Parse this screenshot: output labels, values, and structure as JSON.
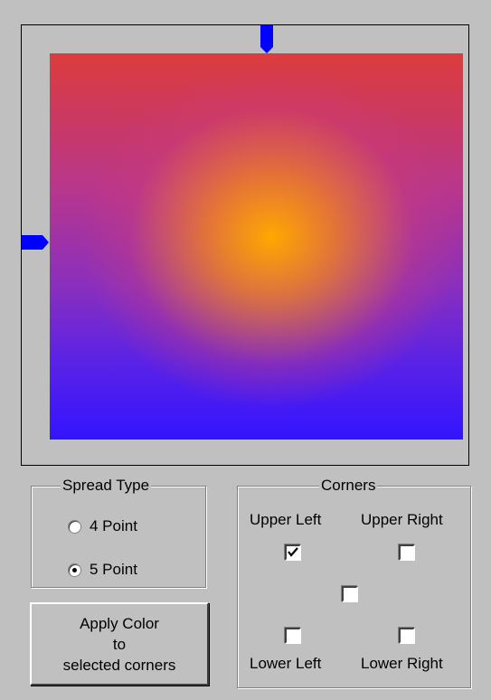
{
  "spread_type": {
    "legend": "Spread Type",
    "options": [
      {
        "label": "4 Point",
        "selected": false
      },
      {
        "label": "5 Point",
        "selected": true
      }
    ]
  },
  "corners": {
    "legend": "Corners",
    "upper_left": {
      "label": "Upper Left",
      "checked": true
    },
    "upper_right": {
      "label": "Upper Right",
      "checked": false
    },
    "center": {
      "checked": false
    },
    "lower_left": {
      "label": "Lower Left",
      "checked": false
    },
    "lower_right": {
      "label": "Lower Right",
      "checked": false
    }
  },
  "apply_button": {
    "line1": "Apply Color",
    "line2": "to",
    "line3": "selected corners"
  },
  "colors": {
    "background": "#c0c0c0",
    "marker": "#0000ff",
    "top_color": "#dc3c3c",
    "center_color": "#ffa800",
    "bottom_color": "#3314ff"
  },
  "icons": {
    "top_marker": "arrow-down-marker-icon",
    "left_marker": "arrow-right-marker-icon",
    "check": "checkmark-icon"
  }
}
